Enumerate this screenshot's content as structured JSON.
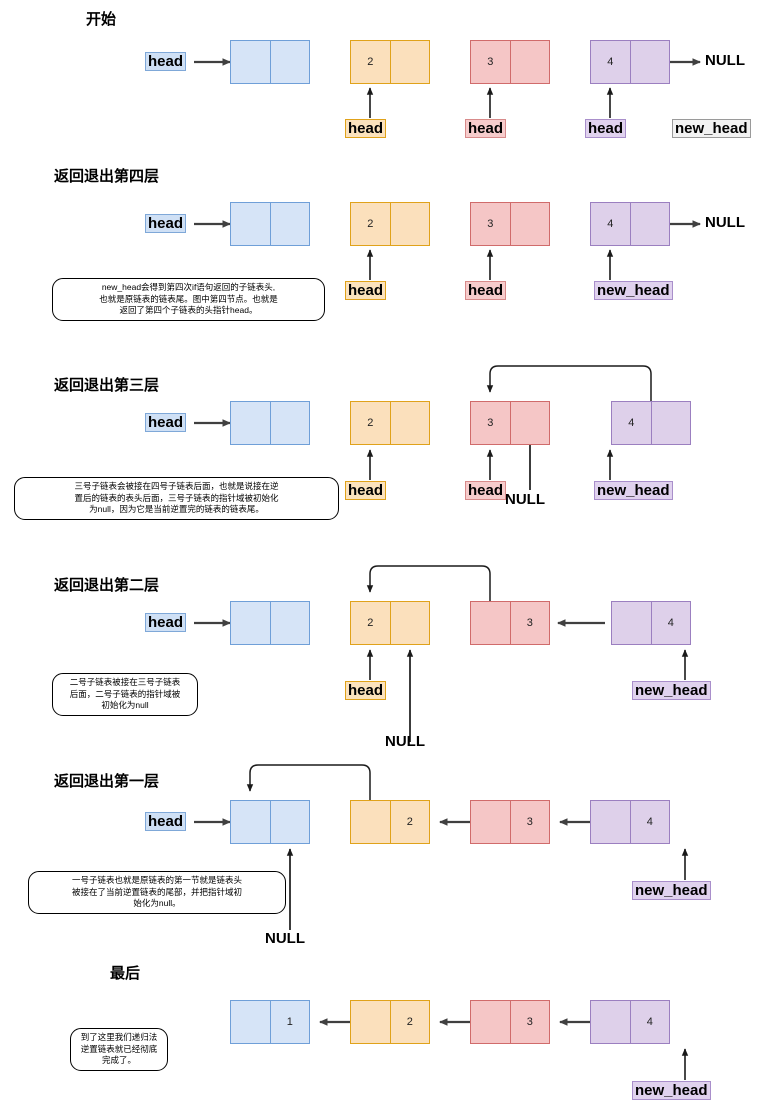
{
  "page": {
    "title_start": "开始",
    "null_label": "NULL"
  },
  "labels": {
    "head": "head",
    "new_head": "new_head",
    "null": "NULL"
  },
  "sections": [
    {
      "id": "start",
      "title": "开始",
      "nodes": [
        {
          "color": "blue",
          "left": "",
          "right": ""
        },
        {
          "color": "orange",
          "left": "2",
          "right": ""
        },
        {
          "color": "red",
          "left": "3",
          "right": ""
        },
        {
          "color": "purple",
          "left": "4",
          "right": ""
        }
      ],
      "chips": [
        {
          "text": "head",
          "color": "blue"
        },
        {
          "text": "head",
          "color": "orange"
        },
        {
          "text": "head",
          "color": "red"
        },
        {
          "text": "head",
          "color": "purple"
        },
        {
          "text": "new_head",
          "color": "grey"
        }
      ],
      "tail": "NULL",
      "callout": ""
    },
    {
      "id": "level4",
      "title": "返回退出第四层",
      "nodes": [
        {
          "color": "blue",
          "left": "",
          "right": ""
        },
        {
          "color": "orange",
          "left": "2",
          "right": ""
        },
        {
          "color": "red",
          "left": "3",
          "right": ""
        },
        {
          "color": "purple",
          "left": "4",
          "right": ""
        }
      ],
      "chips": [
        {
          "text": "head",
          "color": "blue"
        },
        {
          "text": "head",
          "color": "orange"
        },
        {
          "text": "head",
          "color": "red"
        },
        {
          "text": "new_head",
          "color": "purple"
        }
      ],
      "tail": "NULL",
      "callout": "new_head会得到第四次if语句返回的子链表头,<br>也就是原链表的链表尾。图中第四节点。也就是<br>返回了第四个子链表的头指针head。"
    },
    {
      "id": "level3",
      "title": "返回退出第三层",
      "nodes": [
        {
          "color": "blue",
          "left": "",
          "right": ""
        },
        {
          "color": "orange",
          "left": "2",
          "right": ""
        },
        {
          "color": "red",
          "left": "3",
          "right": ""
        },
        {
          "color": "purple",
          "left": "4",
          "right": ""
        }
      ],
      "chips": [
        {
          "text": "head",
          "color": "blue"
        },
        {
          "text": "head",
          "color": "orange"
        },
        {
          "text": "head",
          "color": "red"
        },
        {
          "text": "new_head",
          "color": "purple"
        }
      ],
      "null_marker": "NULL",
      "callout": "三号子链表会被接在四号子链表后面，也就是说接在逆<br>置后的链表的表头后面，三号子链表的指针域被初始化<br>为null，因为它是当前逆置完的链表的链表尾。"
    },
    {
      "id": "level2",
      "title": "返回退出第二层",
      "nodes": [
        {
          "color": "blue",
          "left": "",
          "right": ""
        },
        {
          "color": "orange",
          "left": "2",
          "right": ""
        },
        {
          "color": "red",
          "left": "",
          "right": "3"
        },
        {
          "color": "purple",
          "left": "",
          "right": "4"
        }
      ],
      "chips": [
        {
          "text": "head",
          "color": "blue"
        },
        {
          "text": "head",
          "color": "orange"
        },
        {
          "text": "new_head",
          "color": "purple"
        }
      ],
      "null_marker": "NULL",
      "callout": "二号子链表被接在三号子链表<br>后面，二号子链表的指针域被<br>初始化为null"
    },
    {
      "id": "level1",
      "title": "返回退出第一层",
      "nodes": [
        {
          "color": "blue",
          "left": "",
          "right": ""
        },
        {
          "color": "orange",
          "left": "",
          "right": "2"
        },
        {
          "color": "red",
          "left": "",
          "right": "3"
        },
        {
          "color": "purple",
          "left": "",
          "right": "4"
        }
      ],
      "chips": [
        {
          "text": "head",
          "color": "blue"
        },
        {
          "text": "new_head",
          "color": "purple"
        }
      ],
      "null_marker": "NULL",
      "callout": "一号子链表也就是原链表的第一节就是链表头<br>被接在了当前逆置链表的尾部，并把指针域初<br>始化为null。"
    },
    {
      "id": "final",
      "title": "最后",
      "nodes": [
        {
          "color": "blue",
          "left": "",
          "right": "1"
        },
        {
          "color": "orange",
          "left": "",
          "right": "2"
        },
        {
          "color": "red",
          "left": "",
          "right": "3"
        },
        {
          "color": "purple",
          "left": "",
          "right": "4"
        }
      ],
      "chips": [
        {
          "text": "new_head",
          "color": "purple"
        }
      ],
      "callout": "到了这里我们递归法<br>逆置链表就已经彻底<br>完成了。"
    }
  ],
  "colors": {
    "blue": "#d6e4f7",
    "orange": "#fbe0bc",
    "red": "#f5c6c6",
    "purple": "#ded0ea",
    "arrow": "#404040",
    "thin_arrow": "#1a1a1a"
  }
}
